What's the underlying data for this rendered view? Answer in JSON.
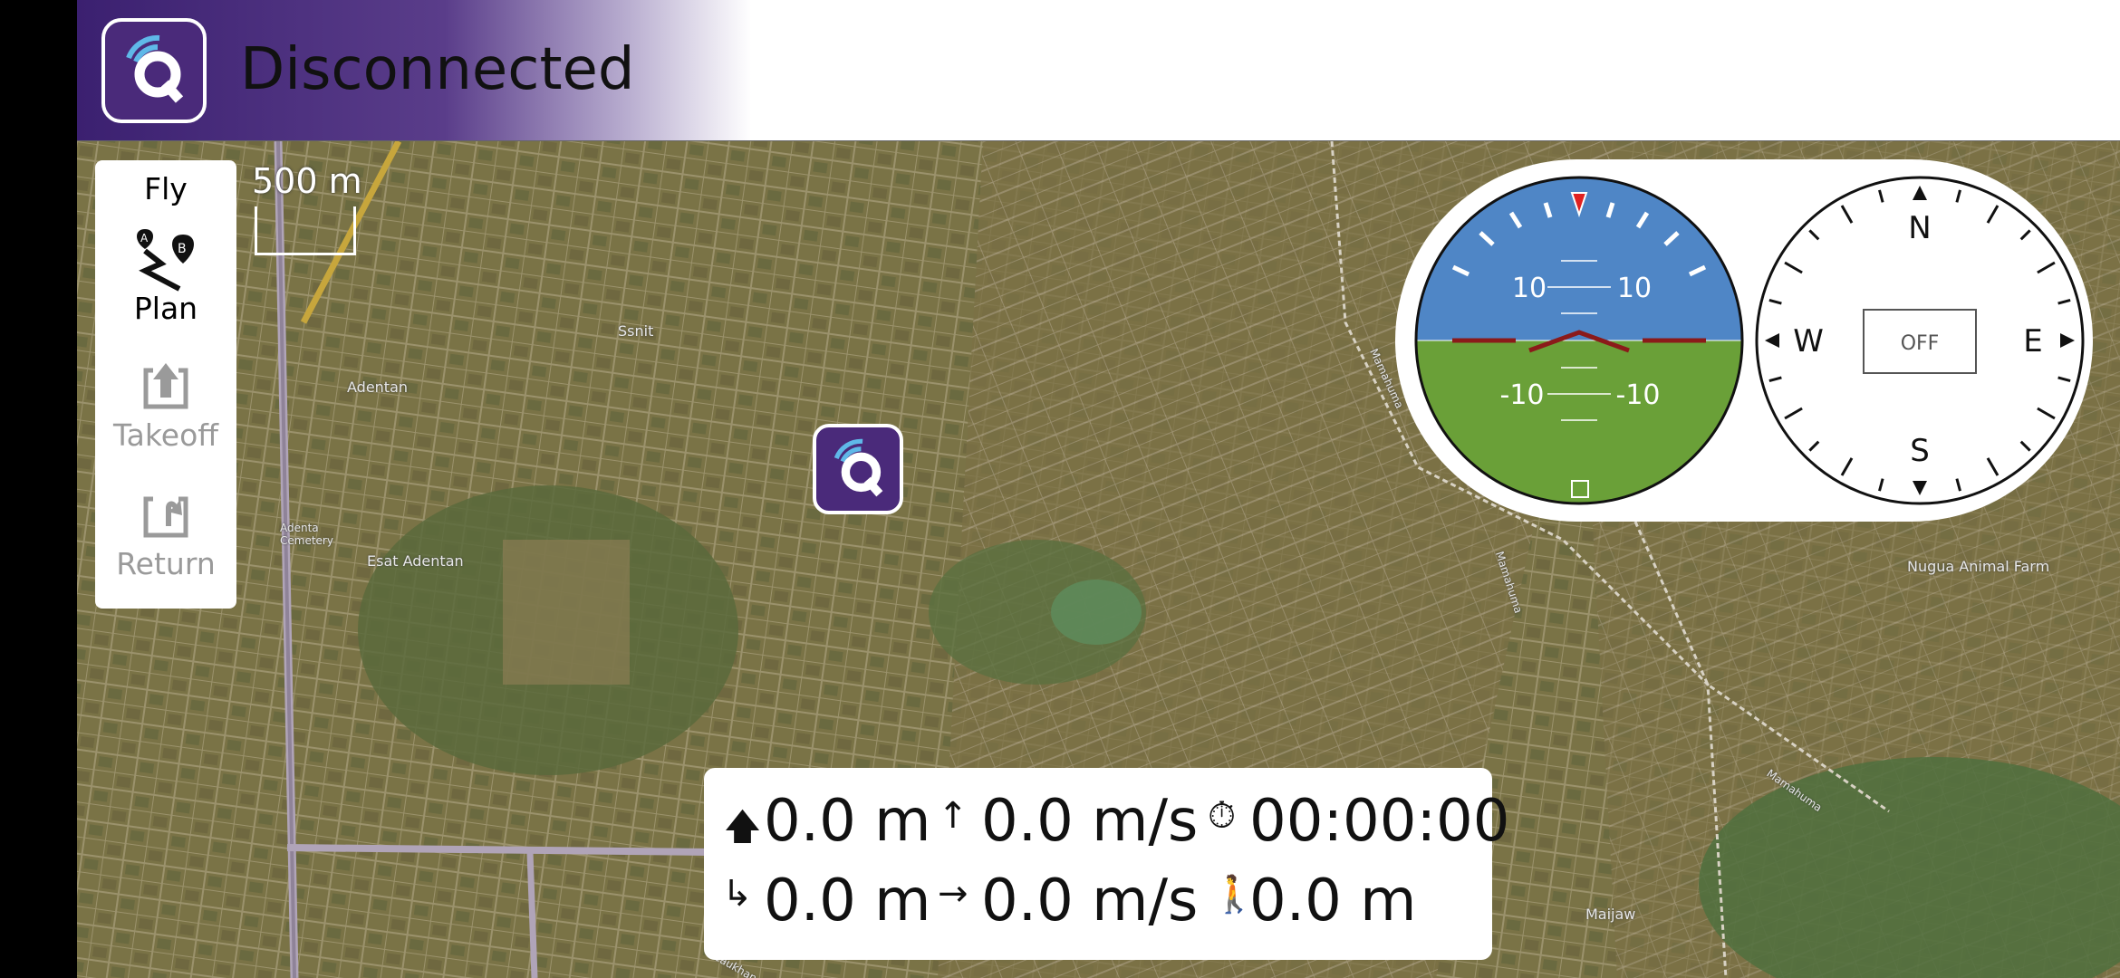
{
  "app": {
    "status": "Disconnected",
    "logo_icon": "qgc-logo-icon",
    "brand_color": "#4a2a7a"
  },
  "toolstrip": {
    "items": [
      {
        "label": "Fly",
        "icon": "",
        "enabled": true
      },
      {
        "label": "Plan",
        "icon": "plan-route-icon",
        "enabled": true
      },
      {
        "label": "Takeoff",
        "icon": "takeoff-icon",
        "enabled": false
      },
      {
        "label": "Return",
        "icon": "return-icon",
        "enabled": false
      }
    ]
  },
  "map": {
    "scale_label": "500 m",
    "labels": [
      "Ssnit",
      "Adentan",
      "Adenta Cemetery",
      "Esat Adentan",
      "Mamahuma",
      "Mamahuma",
      "Nugua Animal Farm",
      "Mamahuma",
      "Maijaw",
      "Caukhan"
    ]
  },
  "attitude": {
    "pitch_labels": [
      "10",
      "10",
      "-10",
      "-10"
    ],
    "sky_color": "#4f86c6",
    "ground_color": "#6aa038"
  },
  "compass": {
    "north": "N",
    "east": "E",
    "south": "S",
    "west": "W",
    "center_label": "OFF"
  },
  "telemetry": {
    "altitude": "0.0 m",
    "vertical_speed": "0.0 m/s",
    "flight_time": "00:00:00",
    "distance": "0.0 m",
    "horizontal_speed": "0.0 m/s",
    "distance_to_home": "0.0 m"
  }
}
